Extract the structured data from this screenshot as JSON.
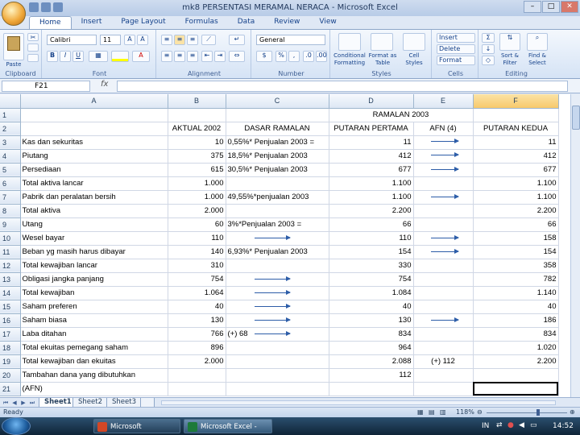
{
  "window": {
    "title": "mk8 PERSENTASI MERAMAL NERACA - Microsoft Excel"
  },
  "ribbon": {
    "tabs": [
      "Home",
      "Insert",
      "Page Layout",
      "Formulas",
      "Data",
      "Review",
      "View"
    ],
    "clipboard": {
      "paste": "Paste",
      "label": "Clipboard"
    },
    "font": {
      "name": "Calibri",
      "size": "11",
      "label": "Font"
    },
    "alignment": {
      "label": "Alignment"
    },
    "number": {
      "format": "General",
      "label": "Number"
    },
    "styles": {
      "conditional": "Conditional Formatting",
      "table": "Format as Table",
      "cell": "Cell Styles",
      "label": "Styles"
    },
    "cells": {
      "insert": "Insert",
      "delete": "Delete",
      "format": "Format",
      "label": "Cells"
    },
    "editing": {
      "sort": "Sort & Filter",
      "find": "Find & Select",
      "label": "Editing"
    }
  },
  "formula_bar": {
    "name_box": "F21",
    "fx": "fx",
    "content": ""
  },
  "grid": {
    "columns": [
      "A",
      "B",
      "C",
      "D",
      "E",
      "F"
    ],
    "rows": [
      {
        "n": "1",
        "A": "",
        "B": "",
        "C": "",
        "D": "RAMALAN 2003",
        "E": "",
        "F": ""
      },
      {
        "n": "2",
        "A": "",
        "B": "AKTUAL 2002",
        "C": "DASAR RAMALAN",
        "D": "PUTARAN PERTAMA",
        "E": "AFN (4)",
        "F": "PUTARAN KEDUA"
      },
      {
        "n": "3",
        "A": "Kas dan sekuritas",
        "B": "10",
        "C": "0,55%* Penjualan 2003 =",
        "D": "11",
        "E": "",
        "F": "11"
      },
      {
        "n": "4",
        "A": "Piutang",
        "B": "375",
        "C": "18,5%* Penjualan 2003",
        "D": "412",
        "E": "",
        "F": "412"
      },
      {
        "n": "5",
        "A": "Persediaan",
        "B": "615",
        "C": "30,5%* Penjualan 2003",
        "D": "677",
        "E": "",
        "F": "677"
      },
      {
        "n": "6",
        "A": "Total aktiva lancar",
        "B": "1.000",
        "C": "",
        "D": "1.100",
        "E": "",
        "F": "1.100"
      },
      {
        "n": "7",
        "A": "Pabrik dan peralatan bersih",
        "B": "1.000",
        "C": "49,55%*penjualan 2003",
        "D": "1.100",
        "E": "",
        "F": "1.100"
      },
      {
        "n": "8",
        "A": "Total aktiva",
        "B": "2.000",
        "C": "",
        "D": "2.200",
        "E": "",
        "F": "2.200"
      },
      {
        "n": "9",
        "A": "Utang",
        "B": "60",
        "C": "3%*Penjualan 2003 =",
        "D": "66",
        "E": "",
        "F": "66"
      },
      {
        "n": "10",
        "A": "Wesel bayar",
        "B": "110",
        "C": "",
        "D": "110",
        "E": "",
        "F": "158"
      },
      {
        "n": "11",
        "A": "Beban yg masih harus dibayar",
        "B": "140",
        "C": "6,93%* Penjualan 2003",
        "D": "154",
        "E": "",
        "F": "154"
      },
      {
        "n": "12",
        "A": "Total kewajiban lancar",
        "B": "310",
        "C": "",
        "D": "330",
        "E": "",
        "F": "358"
      },
      {
        "n": "13",
        "A": "Obligasi jangka panjang",
        "B": "754",
        "C": "",
        "D": "754",
        "E": "",
        "F": "782"
      },
      {
        "n": "14",
        "A": "Total kewajiban",
        "B": "1.064",
        "C": "",
        "D": "1.084",
        "E": "",
        "F": "1.140"
      },
      {
        "n": "15",
        "A": "Saham preferen",
        "B": "40",
        "C": "",
        "D": "40",
        "E": "",
        "F": "40"
      },
      {
        "n": "16",
        "A": "Saham biasa",
        "B": "130",
        "C": "",
        "D": "130",
        "E": "",
        "F": "186"
      },
      {
        "n": "17",
        "A": "Laba ditahan",
        "B": "766",
        "C": "(+) 68",
        "D": "834",
        "E": "",
        "F": "834"
      },
      {
        "n": "18",
        "A": "      Total ekuitas pemegang saham",
        "B": "896",
        "C": "",
        "D": "964",
        "E": "",
        "F": "1.020"
      },
      {
        "n": "19",
        "A": "Total kewajiban dan ekuitas",
        "B": "2.000",
        "C": "",
        "D": "2.088",
        "E": "(+) 112",
        "F": "2.200"
      },
      {
        "n": "20",
        "A": "Tambahan dana yang dibutuhkan",
        "B": "",
        "C": "",
        "D": "112",
        "E": "",
        "F": ""
      },
      {
        "n": "21",
        "A": "(AFN)",
        "B": "",
        "C": "",
        "D": "",
        "E": "",
        "F": ""
      }
    ]
  },
  "sheet_tabs": [
    "Sheet1",
    "Sheet2",
    "Sheet3"
  ],
  "status": {
    "ready": "Ready",
    "zoom": "118%"
  },
  "taskbar": {
    "items": [
      "Microsoft PowerPoi...",
      "Microsoft Excel - mk..."
    ],
    "lang": "IN",
    "time": "14:52"
  },
  "colors": {
    "ribbon": "#dfe8f5",
    "accent": "#15428b",
    "arrow": "#2d5da8",
    "selected_col": "#f7c96b"
  }
}
